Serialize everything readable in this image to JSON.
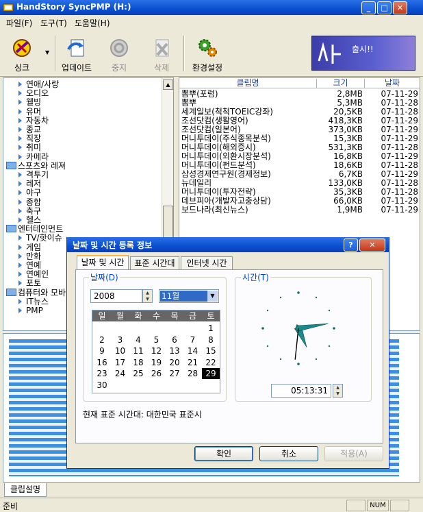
{
  "app": {
    "title": "HandStory SyncPMP (H:)"
  },
  "menu": [
    "파일(F)",
    "도구(T)",
    "도움말(H)"
  ],
  "toolbar": [
    {
      "label": "싱크",
      "icon": "sync-icon",
      "enabled": true
    },
    {
      "label": "업데이트",
      "icon": "update-icon",
      "enabled": true
    },
    {
      "label": "중지",
      "icon": "stop-icon",
      "enabled": false
    },
    {
      "label": "삭제",
      "icon": "delete-icon",
      "enabled": false
    },
    {
      "label": "환경설정",
      "icon": "settings-icon",
      "enabled": true
    }
  ],
  "banner": {
    "text": "출시!!"
  },
  "tree": [
    {
      "label": "연애/사랑",
      "level": 1
    },
    {
      "label": "오디오",
      "level": 1
    },
    {
      "label": "웰빙",
      "level": 1
    },
    {
      "label": "유머",
      "level": 1
    },
    {
      "label": "자동차",
      "level": 1
    },
    {
      "label": "종교",
      "level": 1
    },
    {
      "label": "직장",
      "level": 1
    },
    {
      "label": "취미",
      "level": 1
    },
    {
      "label": "카메라",
      "level": 1
    },
    {
      "label": "스포츠와 레져",
      "level": 0
    },
    {
      "label": "격투기",
      "level": 1
    },
    {
      "label": "레저",
      "level": 1
    },
    {
      "label": "야구",
      "level": 1
    },
    {
      "label": "종합",
      "level": 1
    },
    {
      "label": "축구",
      "level": 1
    },
    {
      "label": "헬스",
      "level": 1
    },
    {
      "label": "엔터테인먼트",
      "level": 0
    },
    {
      "label": "TV/핫이슈",
      "level": 1
    },
    {
      "label": "게임",
      "level": 1
    },
    {
      "label": "만화",
      "level": 1
    },
    {
      "label": "연예",
      "level": 1
    },
    {
      "label": "연예인",
      "level": 1
    },
    {
      "label": "포토",
      "level": 1
    },
    {
      "label": "컴퓨터와 모바",
      "level": 0
    },
    {
      "label": "IT뉴스",
      "level": 1
    },
    {
      "label": "PMP",
      "level": 1
    }
  ],
  "list": {
    "columns": [
      "클립명",
      "크기",
      "날짜"
    ],
    "rows": [
      [
        "뽐뿌(포럼)",
        "2,8MB",
        "07-11-29"
      ],
      [
        "뽐뿌",
        "5,3MB",
        "07-11-28"
      ],
      [
        "세계일보(척척TOEIC강좌)",
        "20,5KB",
        "07-11-28"
      ],
      [
        "조선닷컴(생활영어)",
        "418,3KB",
        "07-11-29"
      ],
      [
        "조선닷컴(일본어)",
        "373,0KB",
        "07-11-29"
      ],
      [
        "머니투데이(주식종목분석)",
        "15,3KB",
        "07-11-29"
      ],
      [
        "머니투데이(해외증시)",
        "531,3KB",
        "07-11-28"
      ],
      [
        "머니투데이(외환시장분석)",
        "16,8KB",
        "07-11-29"
      ],
      [
        "머니투데이(펀드분석)",
        "18,6KB",
        "07-11-28"
      ],
      [
        "삼성경제연구원(경제정보)",
        "6,7KB",
        "07-11-29"
      ],
      [
        "뉴데일리",
        "133,0KB",
        "07-11-28"
      ],
      [
        "머니투데이(투자전략)",
        "35,3KB",
        "07-11-28"
      ],
      [
        "데브피아(개발자고충상담)",
        "66,0KB",
        "07-11-29"
      ],
      [
        "보드나라(최신뉴스)",
        "1,9MB",
        "07-11-29"
      ]
    ]
  },
  "bottom_tab": "클립설명",
  "status": {
    "text": "준비",
    "num": "NUM"
  },
  "dialog": {
    "title": "날짜 및 시간 등록 정보",
    "tabs": [
      "날짜 및 시간",
      "표준 시간대",
      "인터넷 시간"
    ],
    "date_group": "날짜(D)",
    "time_group": "시간(T)",
    "year": "2008",
    "month": "11월",
    "weekdays": [
      "일",
      "월",
      "화",
      "수",
      "목",
      "금",
      "토"
    ],
    "first_weekday": 6,
    "days_in_month": 30,
    "selected_day": 29,
    "time": "05:13:31",
    "clock": {
      "hours": 5,
      "minutes": 13,
      "seconds": 31
    },
    "timezone_text": "현재 표준 시간대: 대한민국 표준시",
    "buttons": {
      "ok": "확인",
      "cancel": "취소",
      "apply": "적용(A)"
    }
  }
}
